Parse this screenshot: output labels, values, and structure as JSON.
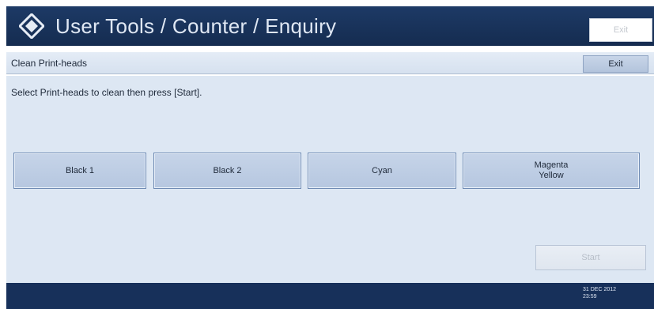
{
  "header": {
    "title": "User Tools / Counter / Enquiry",
    "logo_icon": "diamond-logo-icon",
    "exit_label": "Exit"
  },
  "subbar": {
    "title": "Clean Print-heads",
    "exit_label": "Exit"
  },
  "main": {
    "instruction": "Select Print-heads to clean then press [Start].",
    "heads": [
      {
        "label": "Black 1"
      },
      {
        "label": "Black 2"
      },
      {
        "label": "Cyan"
      },
      {
        "label_line1": "Magenta",
        "label_line2": "Yellow"
      }
    ],
    "start_label": "Start"
  },
  "footer": {
    "date": "31 DEC 2012",
    "time": "23:59"
  },
  "colors": {
    "header_bg": "#1d3a66",
    "panel_bg": "#dde7f3",
    "button_bg": "#c6d4e8",
    "footer_bg": "#17305a"
  }
}
